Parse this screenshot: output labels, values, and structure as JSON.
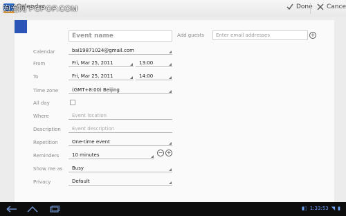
{
  "app": {
    "title": "Calendar",
    "watermark": "泡泡网 PCPOP.COM"
  },
  "actions": {
    "done": "Done",
    "cancel": "Cancel"
  },
  "form": {
    "event_name_placeholder": "Event name",
    "add_guests_label": "Add guests",
    "guests_placeholder": "Enter email addresses",
    "calendar": {
      "label": "Calendar",
      "value": "bai19871024@gmail.com"
    },
    "from": {
      "label": "From",
      "date": "Fri, Mar 25, 2011",
      "time": "13:00"
    },
    "to": {
      "label": "To",
      "date": "Fri, Mar 25, 2011",
      "time": "14:00"
    },
    "timezone": {
      "label": "Time zone",
      "value": "(GMT+8:00) Beijing"
    },
    "allday": {
      "label": "All day",
      "checked": false
    },
    "where": {
      "label": "Where",
      "placeholder": "Event location"
    },
    "description": {
      "label": "Description",
      "placeholder": "Event description"
    },
    "repetition": {
      "label": "Repetition",
      "value": "One-time event"
    },
    "reminders": {
      "label": "Reminders",
      "value": "10 minutes"
    },
    "showme": {
      "label": "Show me as",
      "value": "Busy"
    },
    "privacy": {
      "label": "Privacy",
      "value": "Default"
    }
  },
  "statusbar": {
    "clock": "1:33:53"
  },
  "colors": {
    "accent": "#2b55b7",
    "navbar": "#0d0d0d"
  }
}
